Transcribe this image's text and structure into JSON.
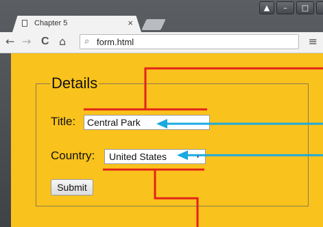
{
  "window": {
    "controls": [
      "▲",
      "–",
      "□",
      "x"
    ]
  },
  "tab": {
    "title": "Chapter 5",
    "close": "×"
  },
  "toolbar": {
    "back": "←",
    "forward": "→",
    "reload": "C",
    "home": "⌂",
    "search_glyph": "⌕",
    "url": "form.html",
    "menu": "≡"
  },
  "form": {
    "legend": "Details",
    "title_label": "Title:",
    "title_value": "Central Park",
    "country_label": "Country:",
    "country_selected": "United States",
    "submit_label": "Submit"
  },
  "colors": {
    "page_bg": "#f9c21c",
    "annotation_red": "#e2231a",
    "annotation_blue": "#1aa9e0"
  }
}
